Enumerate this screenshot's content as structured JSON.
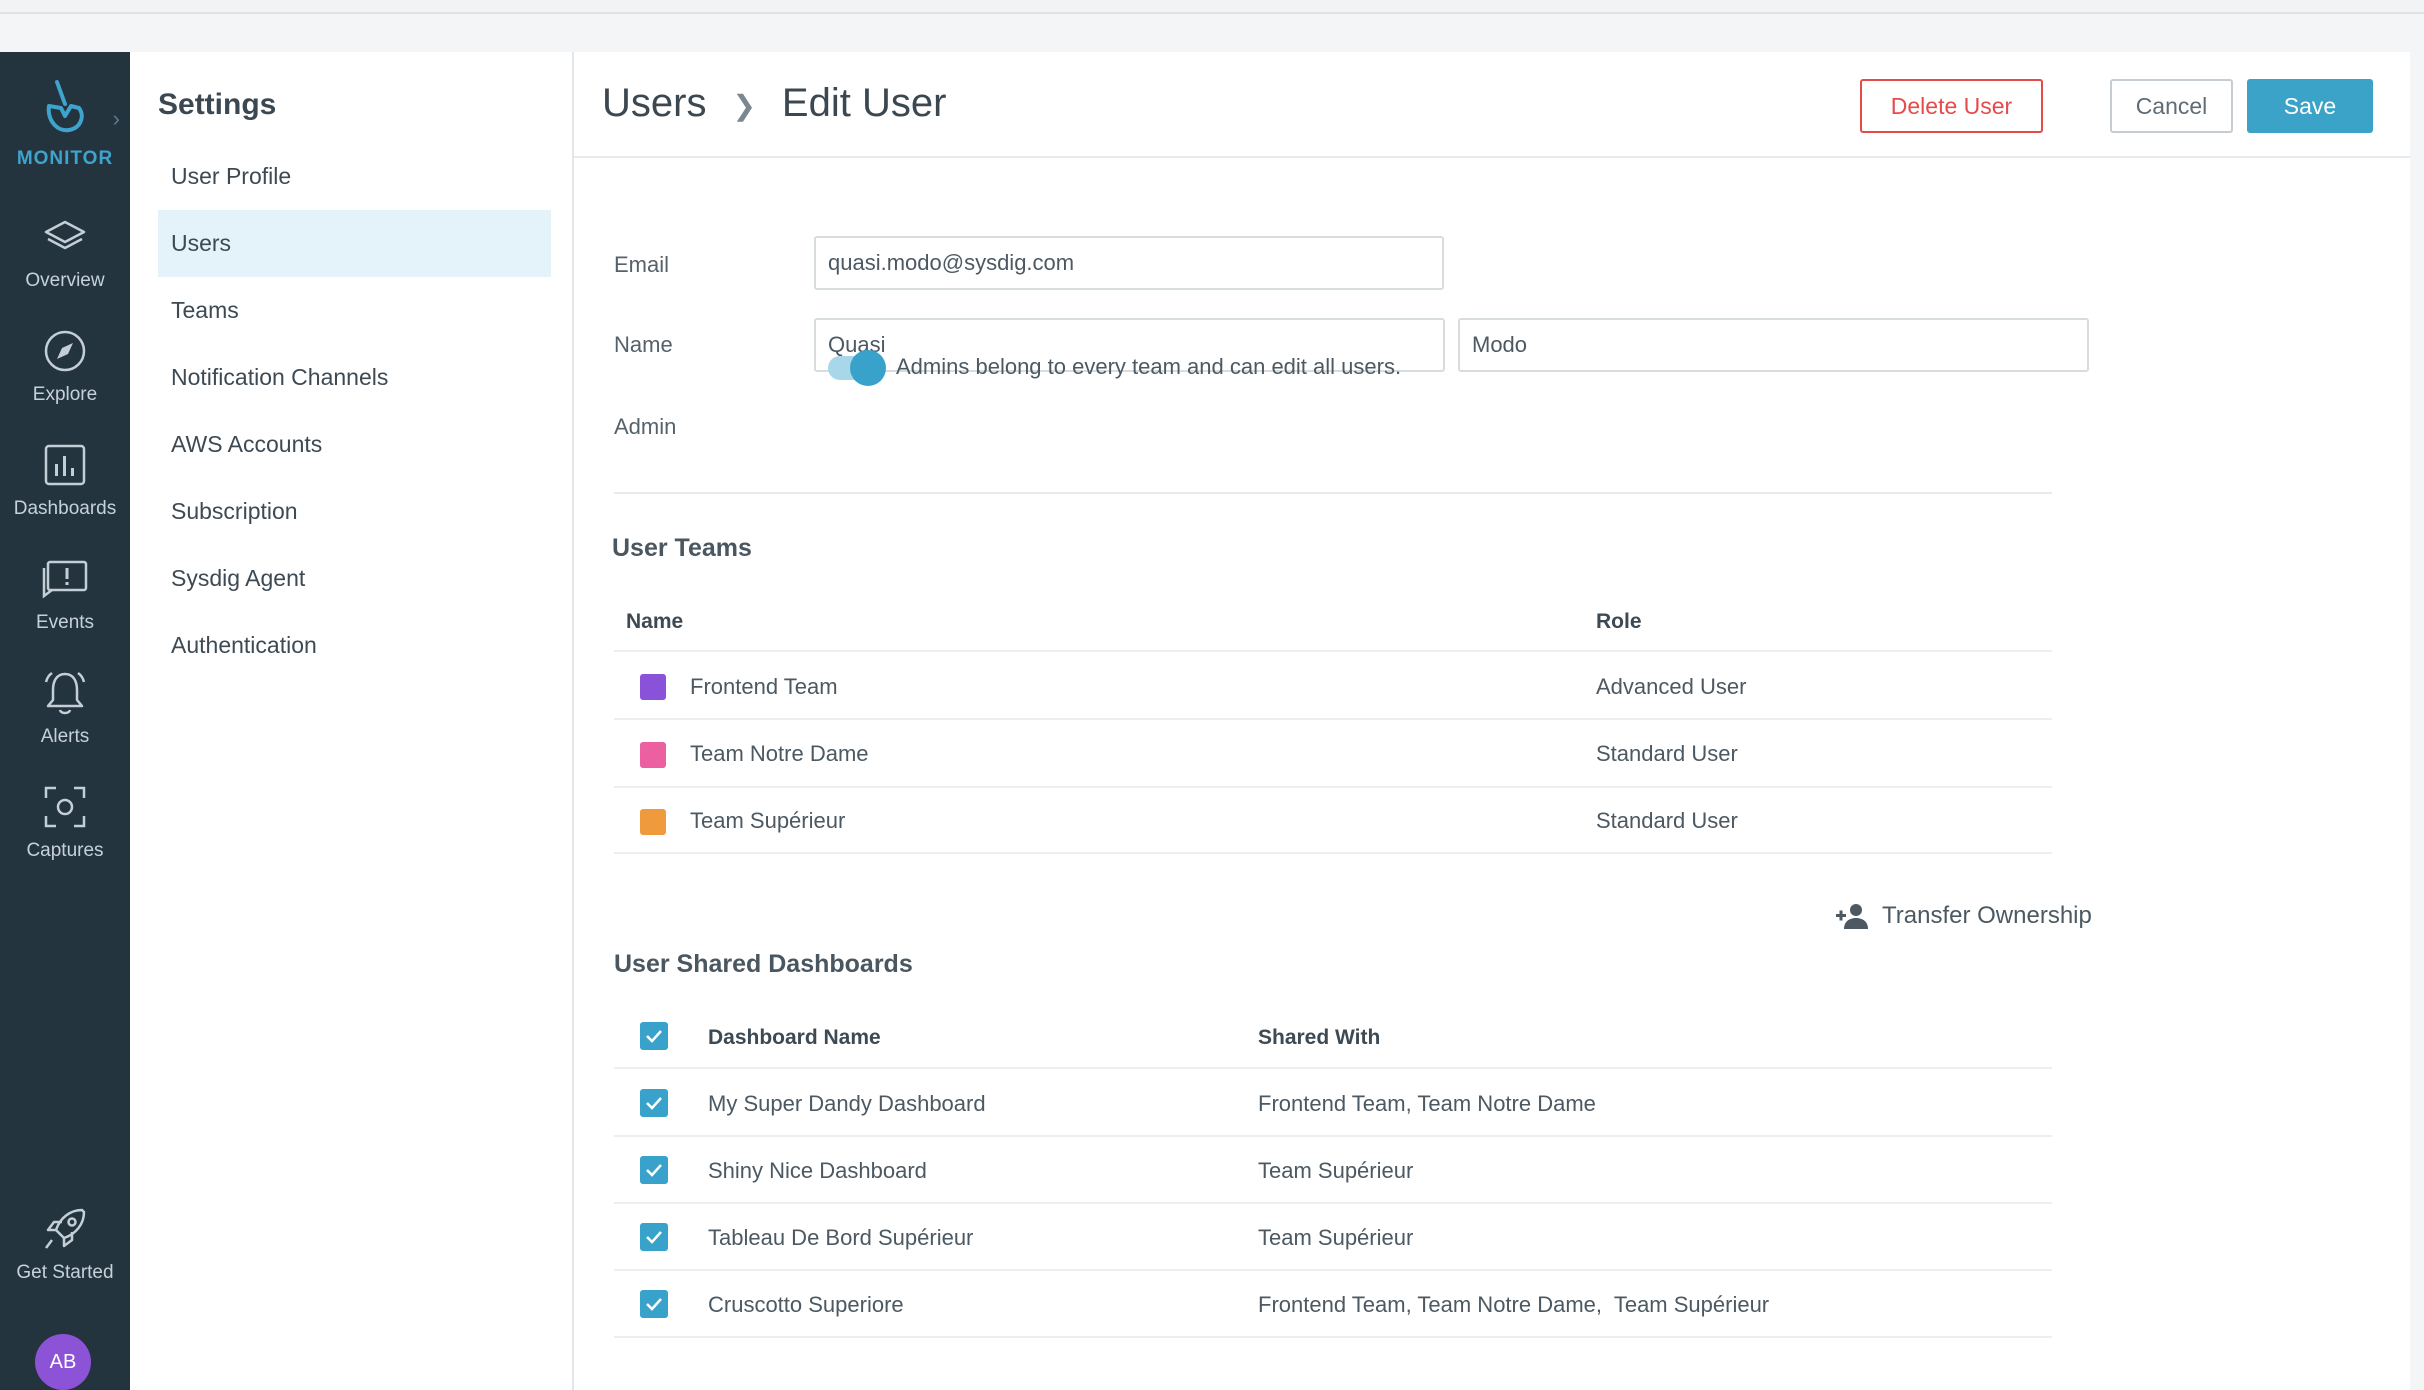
{
  "rail": {
    "brand": "MONITOR",
    "items": [
      {
        "label": "Overview",
        "icon": "layers-icon"
      },
      {
        "label": "Explore",
        "icon": "compass-icon"
      },
      {
        "label": "Dashboards",
        "icon": "bar-chart-icon"
      },
      {
        "label": "Events",
        "icon": "alert-message-icon"
      },
      {
        "label": "Alerts",
        "icon": "bell-icon"
      },
      {
        "label": "Captures",
        "icon": "capture-icon"
      },
      {
        "label": "Get Started",
        "icon": "rocket-icon"
      }
    ],
    "avatar": "AB"
  },
  "settings": {
    "title": "Settings",
    "items": [
      "User Profile",
      "Users",
      "Teams",
      "Notification Channels",
      "AWS Accounts",
      "Subscription",
      "Sysdig Agent",
      "Authentication"
    ],
    "active": "Users"
  },
  "header": {
    "crumb_parent": "Users",
    "crumb_current": "Edit User",
    "delete_label": "Delete User",
    "cancel_label": "Cancel",
    "save_label": "Save"
  },
  "form": {
    "email_label": "Email",
    "email_value": "quasi.modo@sysdig.com",
    "name_label": "Name",
    "first_name": "Quasi",
    "last_name": "Modo",
    "admin_label": "Admin",
    "admin_on": true,
    "admin_desc": "Admins belong to every team and can edit all users."
  },
  "teams": {
    "title": "User Teams",
    "col_name": "Name",
    "col_role": "Role",
    "rows": [
      {
        "name": "Frontend Team",
        "role": "Advanced User",
        "color": "#8a52d8"
      },
      {
        "name": "Team Notre Dame",
        "role": "Standard User",
        "color": "#ec5fa0"
      },
      {
        "name": "Team Supérieur",
        "role": "Standard User",
        "color": "#f09a3e"
      }
    ]
  },
  "dashboards": {
    "title": "User Shared Dashboards",
    "transfer_label": "Transfer Ownership",
    "col_name": "Dashboard Name",
    "col_shared": "Shared With",
    "rows": [
      {
        "name": "My Super Dandy Dashboard",
        "shared": "Frontend Team, Team Notre Dame",
        "checked": true
      },
      {
        "name": "Shiny Nice Dashboard",
        "shared": "Team Supérieur",
        "checked": true
      },
      {
        "name": "Tableau De Bord Supérieur",
        "shared": "Team Supérieur",
        "checked": true
      },
      {
        "name": "Cruscotto Superiore",
        "shared": "Frontend Team, Team Notre Dame,  Team Supérieur",
        "checked": true
      }
    ]
  },
  "colors": {
    "accent": "#38a2cb",
    "danger": "#e64b4b",
    "rail_bg": "#24343f"
  }
}
